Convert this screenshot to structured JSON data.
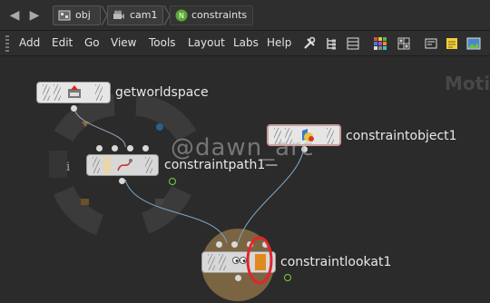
{
  "path_bar": {
    "crumbs": [
      {
        "label": "obj",
        "icon": "obj-network-icon"
      },
      {
        "label": "cam1",
        "icon": "camera-icon"
      },
      {
        "label": "constraints",
        "icon": "chop-network-icon"
      }
    ]
  },
  "menu": {
    "items": [
      "Add",
      "Edit",
      "Go",
      "View",
      "Tools",
      "Layout",
      "Labs",
      "Help"
    ],
    "tools": [
      "wrench-icon",
      "tree-view-icon",
      "list-view-icon",
      "color-palette-icon",
      "grid-icon",
      "note-icon",
      "sticky-note-icon",
      "image-icon"
    ]
  },
  "network": {
    "context_label": "Moti",
    "watermark": "@dawn_arc",
    "nodes": [
      {
        "name": "getworldspace"
      },
      {
        "name": "constraintpath1",
        "suffix": "—"
      },
      {
        "name": "constraintobject1"
      },
      {
        "name": "constraintlookat1"
      }
    ]
  },
  "colors": {
    "highlight_circle": "#e0272b",
    "display_flag": "#7ccf3a",
    "lookat_ring": "#7a6442",
    "wire": "#7fa8c8"
  }
}
